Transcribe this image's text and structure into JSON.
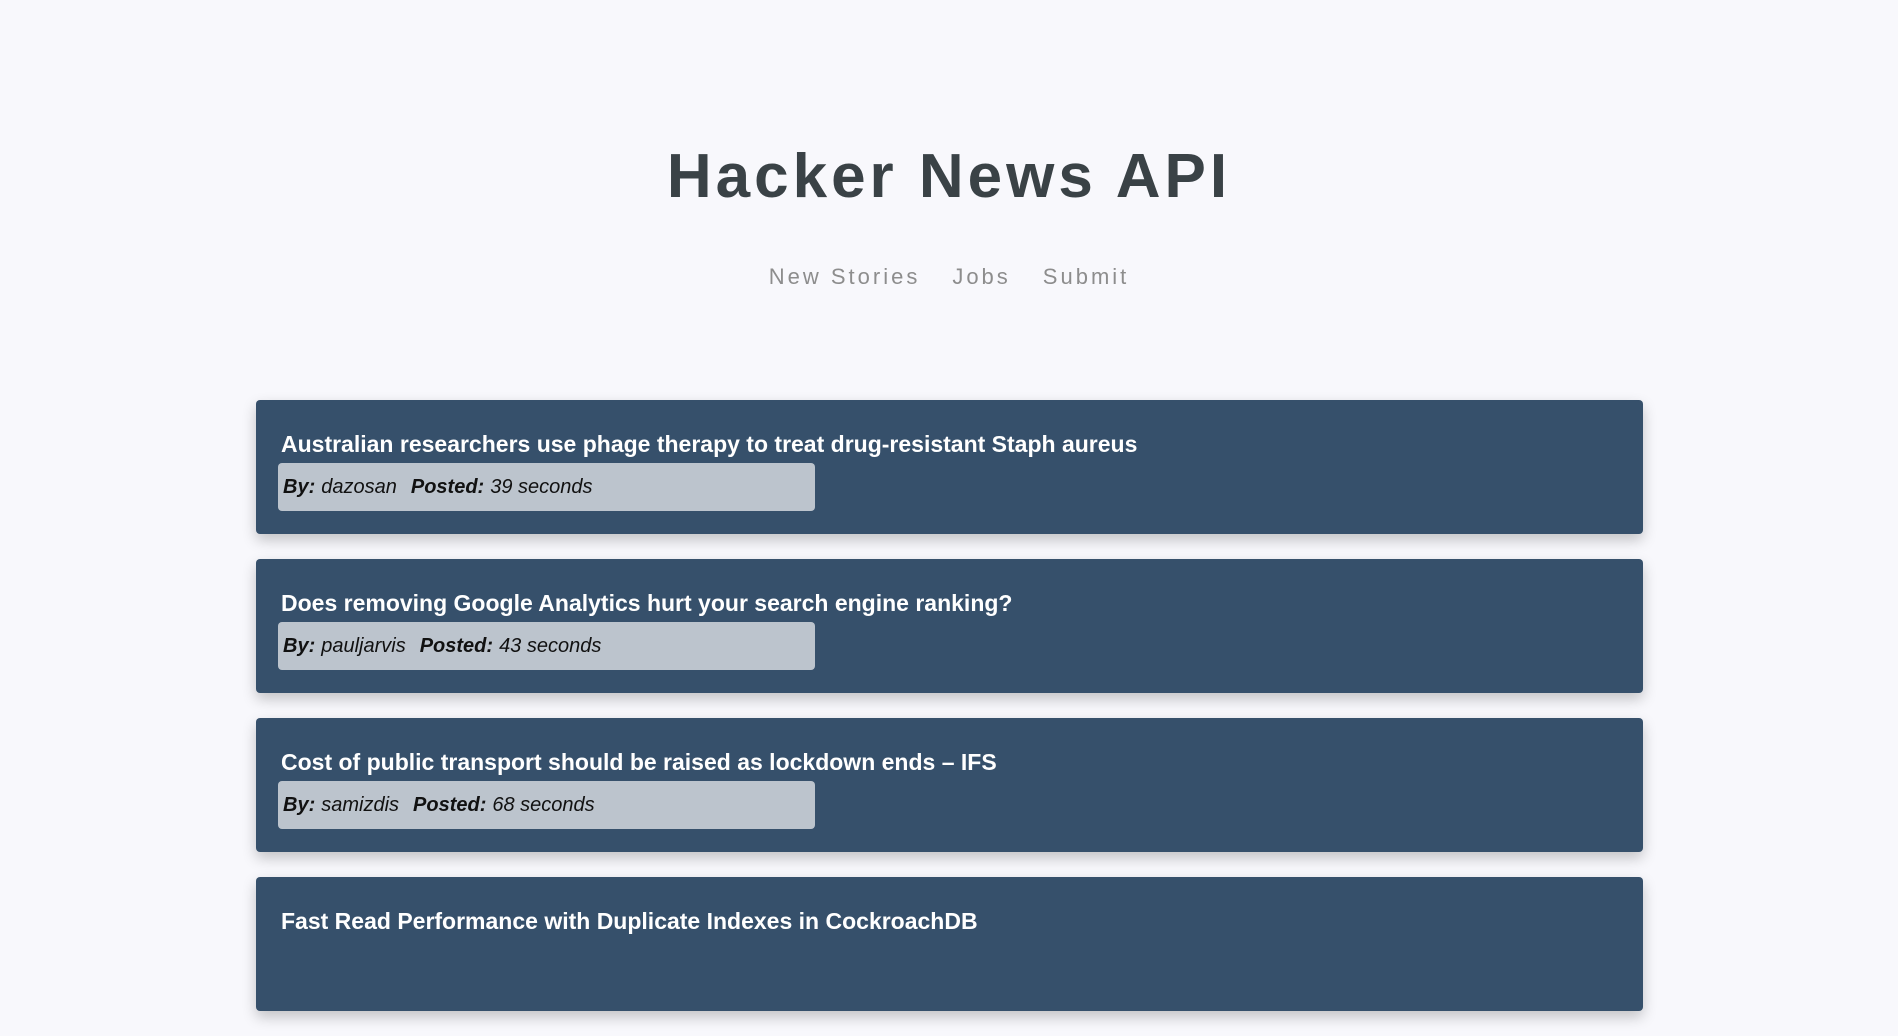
{
  "header": {
    "title": "Hacker News API",
    "nav": [
      {
        "label": "New Stories"
      },
      {
        "label": "Jobs"
      },
      {
        "label": "Submit"
      }
    ]
  },
  "stories": [
    {
      "title": "Australian researchers use phage therapy to treat drug-resistant Staph aureus",
      "by_label": "By:",
      "author": "dazosan",
      "posted_label": "Posted:",
      "posted": "39 seconds"
    },
    {
      "title": "Does removing Google Analytics hurt your search engine ranking?",
      "by_label": "By:",
      "author": "pauljarvis",
      "posted_label": "Posted:",
      "posted": "43 seconds"
    },
    {
      "title": "Cost of public transport should be raised as lockdown ends – IFS",
      "by_label": "By:",
      "author": "samizdis",
      "posted_label": "Posted:",
      "posted": "68 seconds"
    },
    {
      "title": "Fast Read Performance with Duplicate Indexes in CockroachDB",
      "by_label": "",
      "author": "",
      "posted_label": "",
      "posted": ""
    }
  ]
}
